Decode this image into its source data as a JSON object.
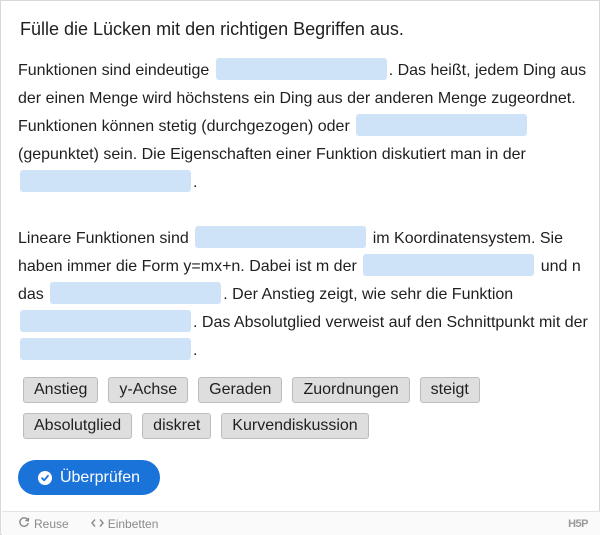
{
  "task": {
    "instruction": "Fülle die Lücken mit den richtigen Begriffen aus."
  },
  "paragraphs": [
    {
      "segments": [
        "Funktionen sind eindeutige",
        ". Das heißt, jedem Ding aus der einen Menge wird höchstens ein Ding aus der anderen Menge zugeordnet. Funktionen können stetig (durchgezogen) oder",
        " (gepunktet) sein. Die Eigenschaften einer Funktion diskutiert man in der",
        "."
      ]
    },
    {
      "segments": [
        "Lineare Funktionen sind",
        " im Koordinatensystem. Sie haben immer die Form y=mx+n. Dabei ist m der",
        " und n das",
        ". Der Anstieg zeigt, wie sehr die Funktion",
        ". Das Absolutglied verweist auf den Schnittpunkt mit der",
        "."
      ]
    }
  ],
  "word_bank": [
    "Anstieg",
    "y-Achse",
    "Geraden",
    "Zuordnungen",
    "steigt",
    "Absolutglied",
    "diskret",
    "Kurvendiskussion"
  ],
  "buttons": {
    "check_label": "Überprüfen"
  },
  "footer": {
    "reuse_label": "Reuse",
    "embed_label": "Einbetten",
    "logo_text": "H5P"
  },
  "colors": {
    "blank": "#cfe3f8",
    "primary": "#1a73d9",
    "chip_bg": "#dedede"
  }
}
